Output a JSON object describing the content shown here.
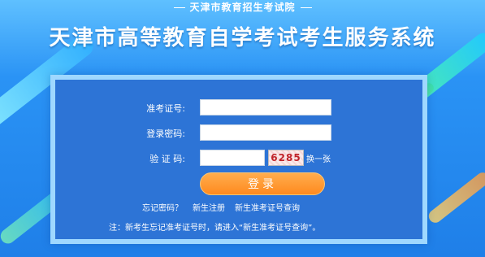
{
  "header": {
    "org": "天津市教育招生考试院",
    "title": "天津市高等教育自学考试考生服务系统"
  },
  "form": {
    "ticket_label": "准考证号:",
    "ticket_value": "",
    "password_label": "登录密码:",
    "password_value": "",
    "captcha_label": "验 证 码:",
    "captcha_value": "",
    "captcha_image_text": "6285",
    "refresh_label": "换一张",
    "login_label": "登录"
  },
  "links": {
    "forgot_password": "忘记密码？",
    "new_register": "新生注册",
    "new_ticket_query": "新生准考证号查询"
  },
  "note": "注：新考生忘记准考证号时，请进入“新生准考证号查询”。",
  "colors": {
    "panel": "#2d74d6",
    "panel_border": "#9fd8ff",
    "button": "#ff8a1f",
    "captcha_text": "#c0242a"
  }
}
